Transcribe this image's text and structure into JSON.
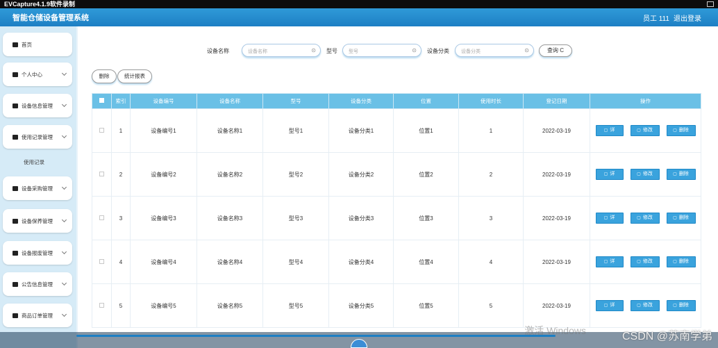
{
  "window": {
    "title": "EVCapture4.1.9软件录制"
  },
  "header": {
    "app_title": "智能仓储设备管理系统",
    "user": "员工 111",
    "logout": "退出登录"
  },
  "sidebar": {
    "items": [
      {
        "label": "首页",
        "icon": "home-icon"
      },
      {
        "label": "个人中心",
        "icon": "user-icon"
      },
      {
        "label": "设备信息管理",
        "icon": "device-icon"
      },
      {
        "label": "使用记录管理",
        "icon": "record-icon"
      },
      {
        "label": "设备采购管理",
        "icon": "purchase-icon"
      },
      {
        "label": "设备保养管理",
        "icon": "maintain-icon"
      },
      {
        "label": "设备报废管理",
        "icon": "scrap-icon"
      },
      {
        "label": "公告信息管理",
        "icon": "notice-icon"
      },
      {
        "label": "商品订单管理",
        "icon": "order-icon"
      }
    ],
    "sub_item": "使用记录"
  },
  "search": {
    "name_label": "设备名称",
    "name_placeholder": "设备名称",
    "model_label": "型号",
    "model_placeholder": "型号",
    "category_label": "设备分类",
    "category_placeholder": "设备分类",
    "clear_glyph": "⊙",
    "query_button": "查询 C"
  },
  "toolbar": {
    "delete_label": "删除",
    "stats_label": "统计报表"
  },
  "table": {
    "headers": [
      "索引",
      "设备编号",
      "设备名称",
      "型号",
      "设备分类",
      "位置",
      "使用时长",
      "登记日期",
      "操作"
    ],
    "rows": [
      {
        "index": "1",
        "code": "设备编号1",
        "name": "设备名称1",
        "model": "型号1",
        "category": "设备分类1",
        "location": "位置1",
        "duration": "1",
        "date": "2022-03-19"
      },
      {
        "index": "2",
        "code": "设备编号2",
        "name": "设备名称2",
        "model": "型号2",
        "category": "设备分类2",
        "location": "位置2",
        "duration": "2",
        "date": "2022-03-19"
      },
      {
        "index": "3",
        "code": "设备编号3",
        "name": "设备名称3",
        "model": "型号3",
        "category": "设备分类3",
        "location": "位置3",
        "duration": "3",
        "date": "2022-03-19"
      },
      {
        "index": "4",
        "code": "设备编号4",
        "name": "设备名称4",
        "model": "型号4",
        "category": "设备分类4",
        "location": "位置4",
        "duration": "4",
        "date": "2022-03-19"
      },
      {
        "index": "5",
        "code": "设备编号5",
        "name": "设备名称5",
        "model": "型号5",
        "category": "设备分类5",
        "location": "位置5",
        "duration": "5",
        "date": "2022-03-19"
      }
    ],
    "ops": {
      "detail": "详情",
      "edit": "修改",
      "remove": "删除"
    }
  },
  "overlay": {
    "activate": "激活 Windows",
    "csdn": "CSDN @苏南学弟"
  },
  "colors": {
    "header": "#1d7fc4",
    "table_header": "#6ac0e6",
    "op_button": "#3aa3dd"
  }
}
